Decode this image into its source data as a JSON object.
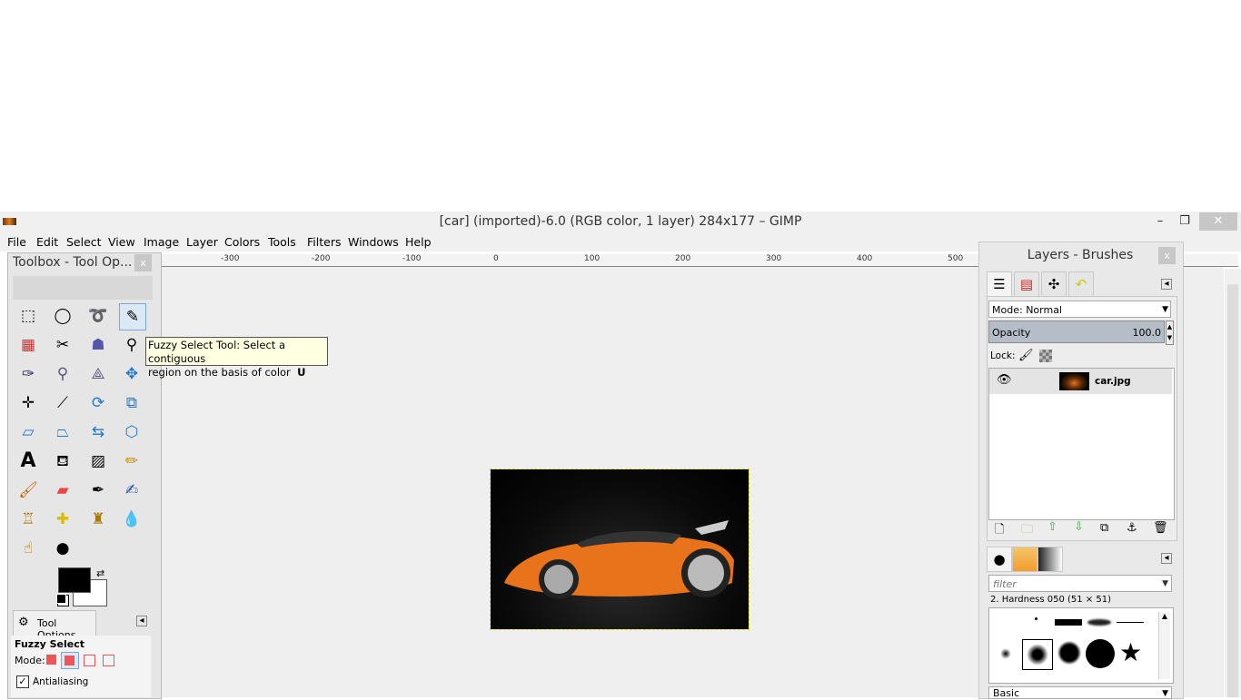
{
  "window": {
    "title": "[car] (imported)-6.0 (RGB color, 1 layer) 284x177 – GIMP",
    "minimize": "–",
    "maximize": "❐",
    "close": "✕"
  },
  "menu": [
    "File",
    "Edit",
    "Select",
    "View",
    "Image",
    "Layer",
    "Colors",
    "Tools",
    "Filters",
    "Windows",
    "Help"
  ],
  "ruler": [
    "-300",
    "-200",
    "-100",
    "0",
    "100",
    "200",
    "300",
    "400",
    "500"
  ],
  "toolbox": {
    "title": "Toolbox - Tool Op...",
    "close": "x",
    "tooltip_line1": "Fuzzy Select Tool: Select a contiguous",
    "tooltip_line2": "region on the basis of color",
    "tooltip_key": "U",
    "tool_options_tab": "Tool Options",
    "tool_name": "Fuzzy Select",
    "mode_label": "Mode:",
    "antialiasing": "Antialiasing"
  },
  "dock": {
    "title": "Layers - Brushes",
    "close": "x",
    "mode_label": "Mode:",
    "mode_value": "Normal",
    "opacity_label": "Opacity",
    "opacity_value": "100.0",
    "lock_label": "Lock:",
    "layer_name": "car.jpg",
    "filter_placeholder": "filter",
    "brush_name": "2. Hardness 050 (51 × 51)",
    "brush_set": "Basic"
  }
}
